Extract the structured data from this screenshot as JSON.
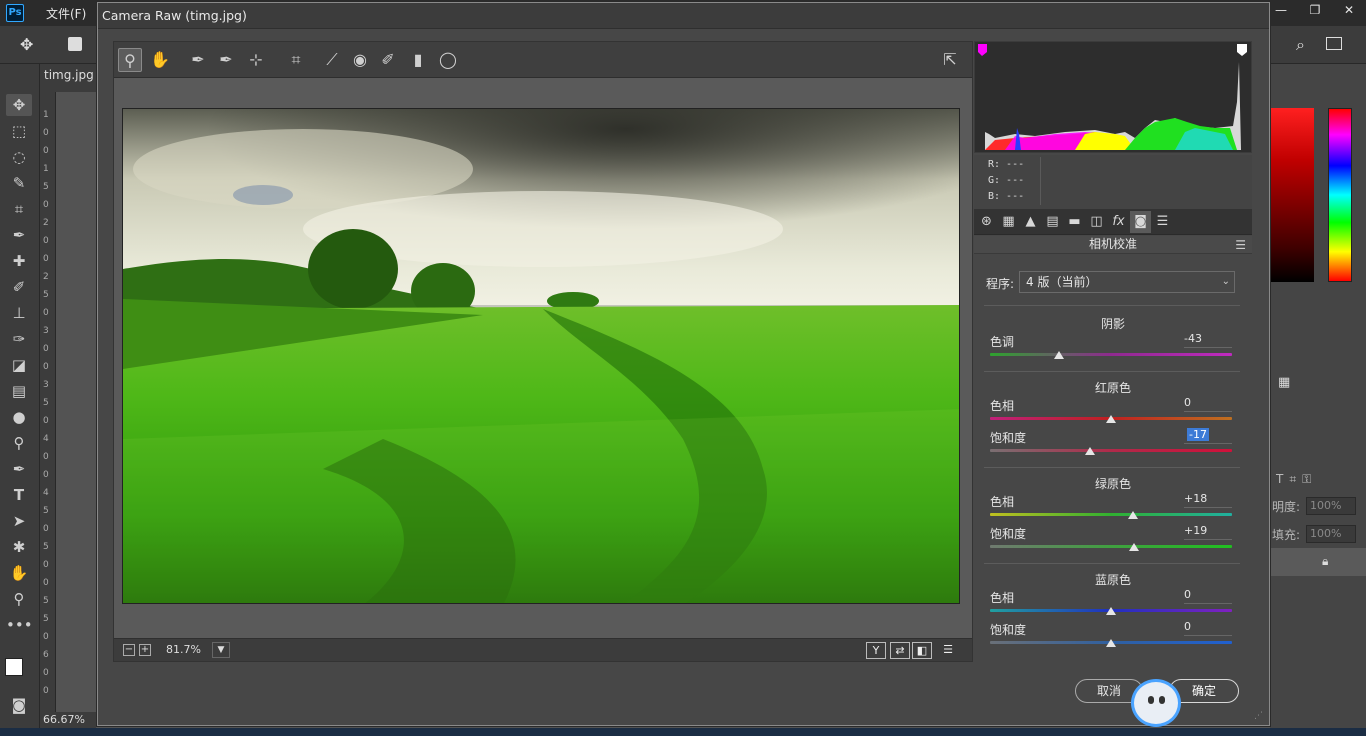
{
  "photoshop": {
    "logo": "Ps",
    "menu_file": "文件(F)",
    "window_controls": [
      "—",
      "❐",
      "✕"
    ],
    "doc_tab": "timg.jpg",
    "zoom_status": "66.67%",
    "ruler_numbers": [
      "1",
      "0",
      "0",
      "1",
      "5",
      "0",
      "2",
      "0",
      "0",
      "2",
      "5",
      "0",
      "3",
      "0",
      "0",
      "3",
      "5",
      "0",
      "4",
      "0",
      "0",
      "4",
      "5",
      "0",
      "5",
      "0",
      "0",
      "5",
      "5",
      "0",
      "6",
      "0",
      "0"
    ],
    "opacity_label": "明度:",
    "opacity_value": "100%",
    "fill_label": "填充:",
    "fill_value": "100%"
  },
  "dialog": {
    "title": "Camera Raw (timg.jpg)",
    "zoom_level": "81.7%",
    "zoom_dropdown_icon": "chevron-down-icon",
    "bottom_view_labels": [
      "Y",
      "⇄",
      "◧",
      "☰"
    ],
    "cancel_label": "取消",
    "ok_label": "确定"
  },
  "rgb_readout": {
    "r": "R:  ---",
    "g": "G:  ---",
    "b": "B:  ---"
  },
  "panel": {
    "title": "相机校准",
    "process_label": "程序:",
    "process_value": "4 版（当前）",
    "sections": {
      "shadows": {
        "title": "阴影",
        "tint_label": "色调",
        "tint_value": "-43"
      },
      "red": {
        "title": "红原色",
        "hue_label": "色相",
        "hue_value": "0",
        "sat_label": "饱和度",
        "sat_value": "-17"
      },
      "green": {
        "title": "绿原色",
        "hue_label": "色相",
        "hue_value": "+18",
        "sat_label": "饱和度",
        "sat_value": "+19"
      },
      "blue": {
        "title": "蓝原色",
        "hue_label": "色相",
        "hue_value": "0",
        "sat_label": "饱和度",
        "sat_value": "0"
      }
    }
  },
  "slider_levels": {
    "shadows_tint": -43,
    "red_hue": 0,
    "red_saturation": -17,
    "green_hue": 18,
    "green_saturation": 19,
    "blue_hue": 0,
    "blue_saturation": 0,
    "range": [
      -100,
      100
    ]
  },
  "colors": {
    "accent_selection": "#3d7bd6",
    "shadow_clip_indicator": "#ff00ff",
    "highlight_clip_indicator": "#ffffff"
  }
}
